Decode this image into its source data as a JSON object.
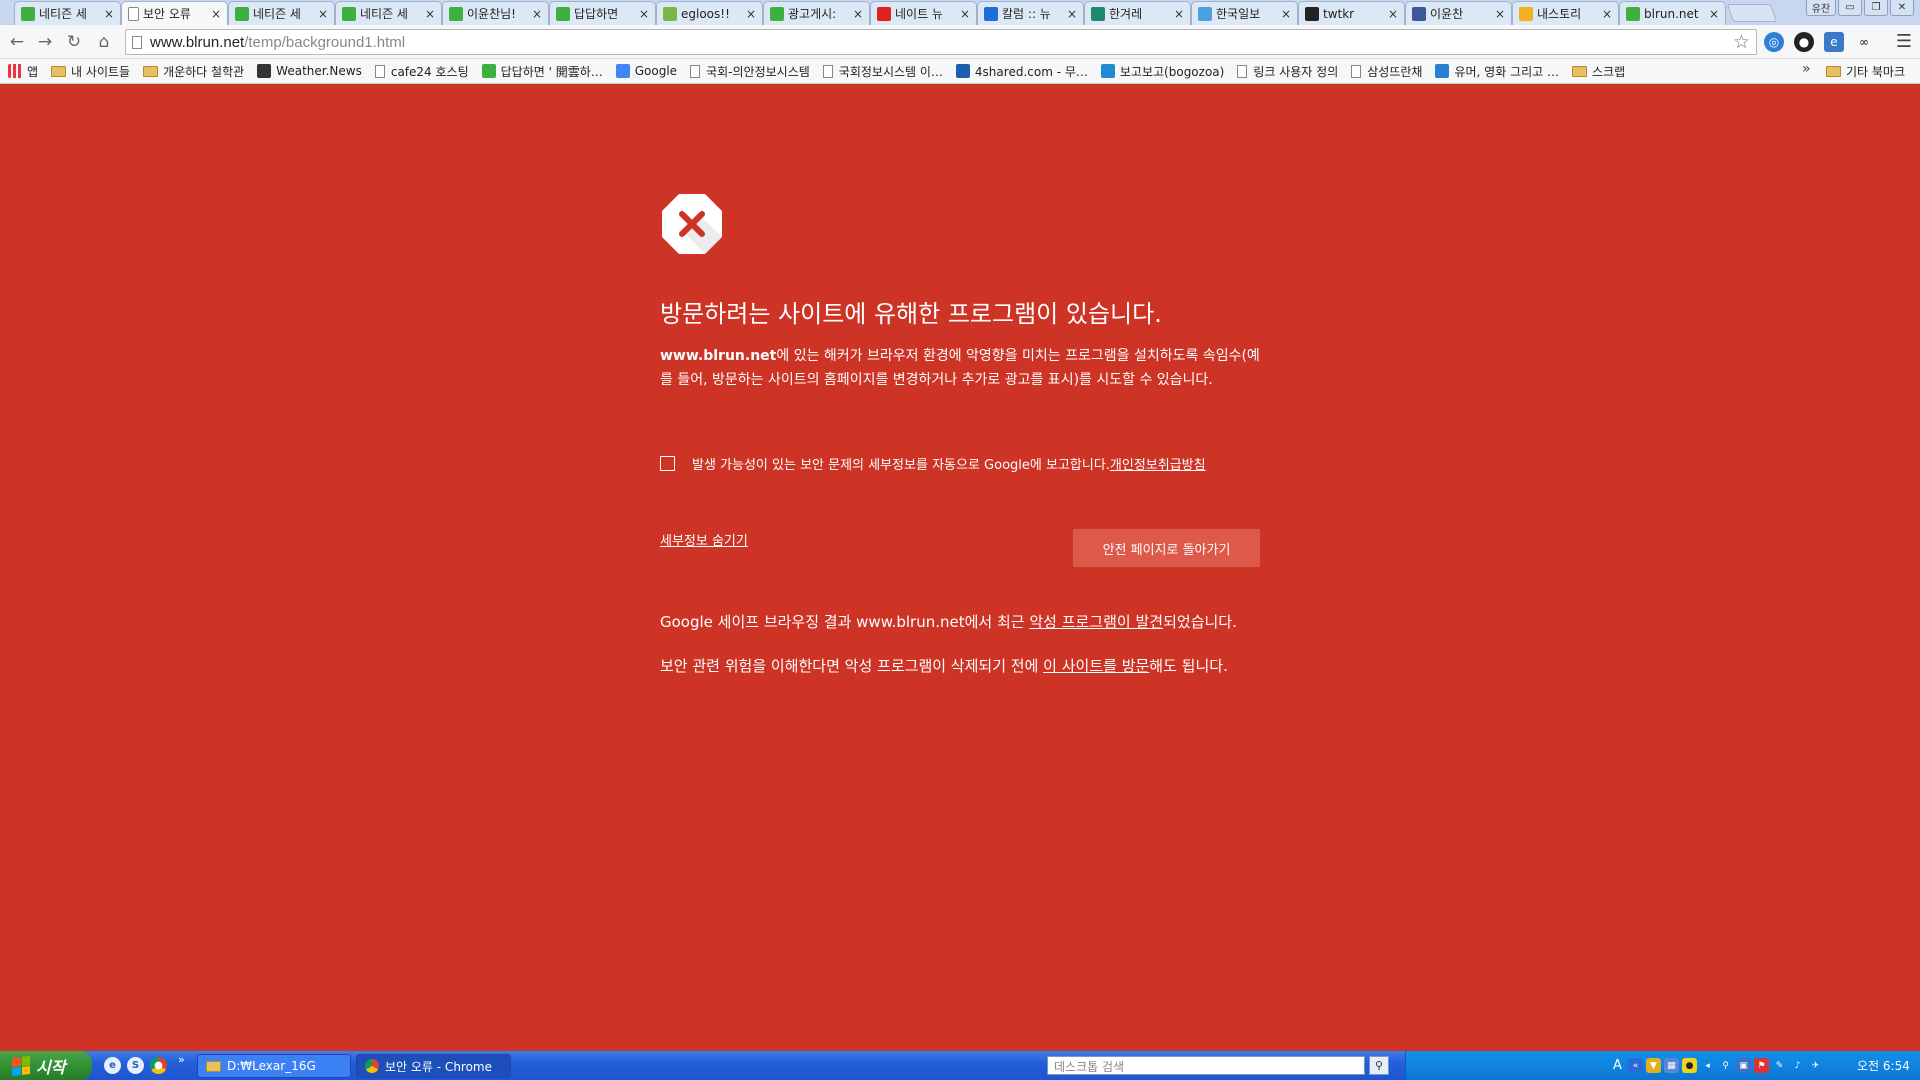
{
  "browser": {
    "tabs": [
      {
        "title": "네티즌 세",
        "favicon": "naver-bird-icon",
        "color": "#3db03d",
        "active": false
      },
      {
        "title": "보안 오류",
        "favicon": "page-icon",
        "color": "#888888",
        "active": true
      },
      {
        "title": "네티즌 세",
        "favicon": "naver-bird-icon",
        "color": "#3db03d",
        "active": false
      },
      {
        "title": "네티즌 세",
        "favicon": "naver-bird-icon",
        "color": "#3db03d",
        "active": false
      },
      {
        "title": "이윤찬님!",
        "favicon": "naver-bird-icon",
        "color": "#3db03d",
        "active": false
      },
      {
        "title": "답답하면",
        "favicon": "naver-bird-icon",
        "color": "#3db03d",
        "active": false
      },
      {
        "title": "egloos!!",
        "favicon": "egloos-icon",
        "color": "#7ab648",
        "active": false
      },
      {
        "title": "광고게시:",
        "favicon": "naver-bird-icon",
        "color": "#3db03d",
        "active": false
      },
      {
        "title": "네이트 뉴",
        "favicon": "nate-icon",
        "color": "#e0231f",
        "active": false
      },
      {
        "title": "칼럼 :: 뉴",
        "favicon": "z-icon",
        "color": "#1c6ed8",
        "active": false
      },
      {
        "title": "한겨레",
        "favicon": "hani-icon",
        "color": "#1d8a6b",
        "active": false
      },
      {
        "title": "한국일보",
        "favicon": "hankook-icon",
        "color": "#4aa0e0",
        "active": false
      },
      {
        "title": "twtkr",
        "favicon": "twtkr-icon",
        "color": "#222222",
        "active": false
      },
      {
        "title": "이윤찬",
        "favicon": "facebook-icon",
        "color": "#3b5998",
        "active": false
      },
      {
        "title": "내스토리",
        "favicon": "story-icon",
        "color": "#f2b01c",
        "active": false
      },
      {
        "title": "blrun.net",
        "favicon": "naver-bird-icon",
        "color": "#3db03d",
        "active": false
      }
    ],
    "window_controls": {
      "user": "유찬",
      "minimize": "▭",
      "restore": "❐",
      "close": "✕"
    },
    "url": {
      "host": "www.blrun.net",
      "path": "/temp/background1.html"
    },
    "bookmarks": [
      {
        "label": "앱",
        "icon": "apps-grid-icon"
      },
      {
        "label": "내 사이트들",
        "icon": "folder-icon"
      },
      {
        "label": "개운하다 철학관",
        "icon": "folder-icon"
      },
      {
        "label": "Weather.News",
        "icon": "weather-icon"
      },
      {
        "label": "cafe24 호스팅",
        "icon": "page-icon"
      },
      {
        "label": "답답하면 ' 開雲하…",
        "icon": "naver-bird-icon"
      },
      {
        "label": "Google",
        "icon": "google-icon"
      },
      {
        "label": "국회-의안정보시스템",
        "icon": "page-icon"
      },
      {
        "label": "국회정보시스템 이…",
        "icon": "page-icon"
      },
      {
        "label": "4shared.com - 무…",
        "icon": "4shared-icon"
      },
      {
        "label": "보고보고(bogozoa)",
        "icon": "bogozoa-icon"
      },
      {
        "label": "링크 사용자 정의",
        "icon": "page-icon"
      },
      {
        "label": "삼성뜨란채",
        "icon": "page-icon"
      },
      {
        "label": "유머, 영화 그리고 …",
        "icon": "humor-icon"
      },
      {
        "label": "스크랩",
        "icon": "folder-icon"
      }
    ],
    "bookmarks_more": "»",
    "bookmarks_other": "기타 북마크"
  },
  "interstitial": {
    "heading": "방문하려는 사이트에 유해한 프로그램이 있습니다.",
    "desc_site": "www.blrun.net",
    "desc_text": "에 있는 해커가 브라우저 환경에 악영향을 미치는 프로그램을 설치하도록 속임수(예를 들어, 방문하는 사이트의 홈페이지를 변경하거나 추가로 광고를 표시)를 시도할 수 있습니다.",
    "report_label": "발생 가능성이 있는 보안 문제의 세부정보를 자동으로 Google에 보고합니다. ",
    "privacy_link": "개인정보취급방침",
    "hide_details": "세부정보 숨기기",
    "safe_button": "안전 페이지로 돌아가기",
    "details1_pre": "Google 세이프 브라우징 결과 www.blrun.net에서 최근 ",
    "details1_link": "악성 프로그램이 발견",
    "details1_post": "되었습니다.",
    "details2_pre": "보안 관련 위험을 이해한다면 악성 프로그램이 삭제되기 전에 ",
    "details2_link": "이 사이트를 방문",
    "details2_post": "해도 됩니다."
  },
  "taskbar": {
    "start_label": "시작",
    "more": "»",
    "items": [
      {
        "label": "D:₩Lexar_16G",
        "icon": "folder-icon"
      },
      {
        "label": "보안 오류 - Chrome",
        "icon": "chrome-icon"
      }
    ],
    "search_placeholder": "데스크톱 검색",
    "clock": "오전 6:54"
  }
}
